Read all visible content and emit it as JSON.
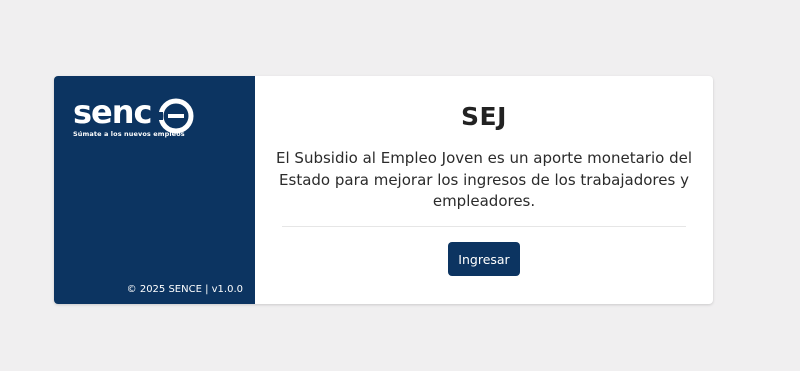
{
  "brand": {
    "logo_text": "senc",
    "slogan": "Súmate a los nuevos empleos",
    "footer": "© 2025 SENCE | v1.0.0"
  },
  "main": {
    "title": "SEJ",
    "description": "El Subsidio al Empleo Joven es un aporte monetario del Estado para mejorar los ingresos de los trabajadores y empleadores.",
    "button_label": "Ingresar"
  },
  "colors": {
    "brand_blue": "#0c3461",
    "page_background": "#f0eff0"
  }
}
